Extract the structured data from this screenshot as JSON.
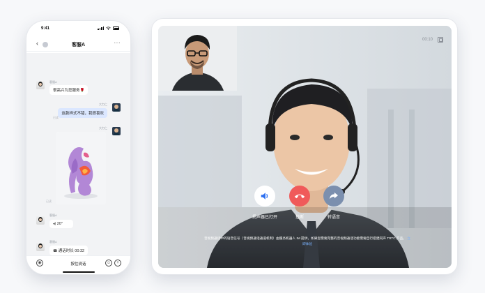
{
  "phone": {
    "status_time": "9:41",
    "nav": {
      "back_icon": "chevron-left-icon",
      "unread_badge": "",
      "title": "客服A",
      "more_icon": "more-icon"
    },
    "messages": [
      {
        "from": "agent",
        "sender": "客服A",
        "text": "很高兴为您服务🌹"
      },
      {
        "from": "user",
        "sender": "大力仁",
        "text": "这款样式不错，我很喜欢",
        "read": "已读"
      },
      {
        "from": "user",
        "sender": "大力仁",
        "kind": "image",
        "read": "已读"
      },
      {
        "from": "agent",
        "sender": "客服A",
        "kind": "voice",
        "text": "20\""
      },
      {
        "from": "agent",
        "sender": "客服A",
        "kind": "call",
        "text": "通话时长 00:32"
      }
    ],
    "input": {
      "voice_icon": "microphone-icon",
      "hold_to_talk": "按住说话",
      "emoji_icon": "emoji-icon",
      "add_icon": "plus-icon"
    }
  },
  "video": {
    "call_timer": "00:10",
    "minimize_icon": "minimize-window-icon",
    "controls": [
      {
        "icon": "speaker-icon",
        "label": "扬声器已打开",
        "color": "#ffffff"
      },
      {
        "icon": "hang-up-icon",
        "label": "挂断",
        "color": "#f05a5a"
      },
      {
        "icon": "transfer-voice-icon",
        "label": "转语音",
        "color": "#7b8fae"
      }
    ],
    "notice": "音视频通话中的语音信号（音视频通话通道机制）由服务机器人 IM 提供，如果您需要完整的音视频通话功能需要自行搭建同声 TRTC 产品。",
    "notice_link": "立即体验"
  }
}
